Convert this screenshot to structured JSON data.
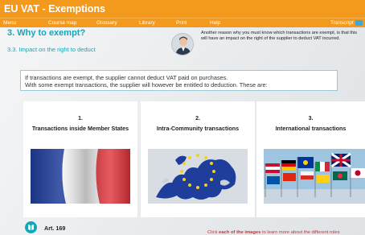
{
  "app": {
    "title": "EU VAT - Exemptions",
    "accent": "#f39a1d",
    "teal": "#15a6b8"
  },
  "menu": {
    "items": [
      "Menu",
      "Course map",
      "Glossary",
      "Library",
      "Print",
      "Help"
    ],
    "transcript": "Transcript"
  },
  "section": {
    "title": "3. Why to exempt?",
    "subtitle": "3.3. Impact on the right to deduct"
  },
  "narrator": {
    "text": "Another reason why you must know which transactions are exempt, is that this will have an impact on the right of the supplier to deduct VAT incurred."
  },
  "info": {
    "line1": "If transactions are exempt, the supplier cannot deduct VAT paid on purchases.",
    "line2": "With some exempt transactions, the supplier will however be entitled to deduction. These are:"
  },
  "cards": [
    {
      "number": "1.",
      "title": "Transactions inside Member States",
      "image": "french-flag"
    },
    {
      "number": "2.",
      "title": "Intra-Community transactions",
      "image": "eu-map"
    },
    {
      "number": "3.",
      "title": "International transactions",
      "image": "world-flags"
    }
  ],
  "footer": {
    "article": "Art. 169",
    "hint_pre": "Click ",
    "hint_bold": "each of the images",
    "hint_post": " to learn more about the different roles"
  }
}
